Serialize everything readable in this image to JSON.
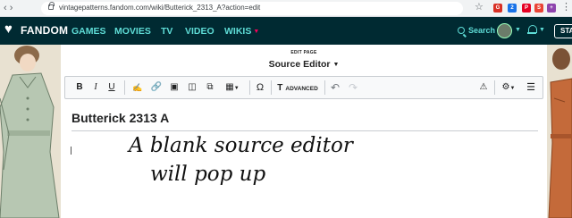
{
  "browser": {
    "url": "vintagepatterns.fandom.com/wiki/Butterick_2313_A?action=edit",
    "extensions": [
      {
        "name": "extension-icon",
        "color": "#d93025",
        "text": "G"
      },
      {
        "name": "extension-icon",
        "color": "#1a73e8",
        "text": "2"
      },
      {
        "name": "extension-icon",
        "color": "#e60023",
        "text": "P"
      },
      {
        "name": "extension-icon",
        "color": "#ea4335",
        "text": "S"
      },
      {
        "name": "extension-icon",
        "color": "#8e44ad",
        "text": "+"
      },
      {
        "name": "extension-icon",
        "color": "#5f6368",
        "text": "≡"
      }
    ]
  },
  "header": {
    "logo": "FANDOM",
    "nav": [
      "GAMES",
      "MOVIES",
      "TV",
      "VIDEO",
      "WIKIS"
    ],
    "search_label": "Search",
    "start_label": "STA"
  },
  "editor": {
    "edit_page_label": "EDIT PAGE",
    "mode_title": "Source Editor",
    "advanced_label": "ADVANCED",
    "page_title": "Butterick 2313 A"
  },
  "annotation": {
    "line1": "A blank source editor",
    "line2": "will pop up"
  },
  "colors": {
    "fandom_bg": "#002a32",
    "fandom_accent": "#5edcd6",
    "fandom_red": "#fa005a"
  }
}
